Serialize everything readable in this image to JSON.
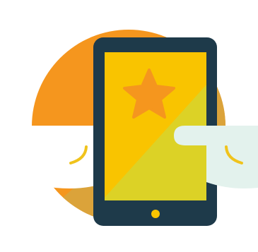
{
  "illustration": {
    "icon": "tablet-star-icon",
    "colors": {
      "background": "#ffffff",
      "circle_orange": "#f5961e",
      "circle_gold": "#dba33a",
      "tablet_frame": "#1e3a4a",
      "screen_yellow": "#f9c400",
      "screen_lime": "#dcd226",
      "star": "#f5961e",
      "home_button": "#f9c400",
      "hand_white": "#ffffff",
      "hand_mint": "#e3f2ed",
      "thumb_stroke": "#f0c31c"
    }
  }
}
